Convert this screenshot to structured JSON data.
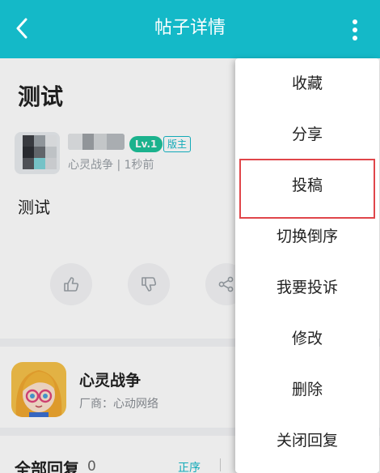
{
  "header": {
    "title": "帖子详情"
  },
  "post": {
    "title": "测试",
    "badge_level": "Lv.1",
    "badge_role": "版主",
    "meta": "心灵战争 | 1秒前",
    "body": "测试"
  },
  "game": {
    "name": "心灵战争",
    "vendor": "厂商：心动网络"
  },
  "replies": {
    "title": "全部回复",
    "count": "0",
    "sort": "正序"
  },
  "menu": {
    "items": [
      "收藏",
      "分享",
      "投稿",
      "切换倒序",
      "我要投诉",
      "修改",
      "删除",
      "关闭回复"
    ],
    "highlighted": "投稿"
  },
  "colors": {
    "accent": "#14b9c8",
    "level_badge": "#1ec29a",
    "highlight_border": "#e0464a"
  }
}
